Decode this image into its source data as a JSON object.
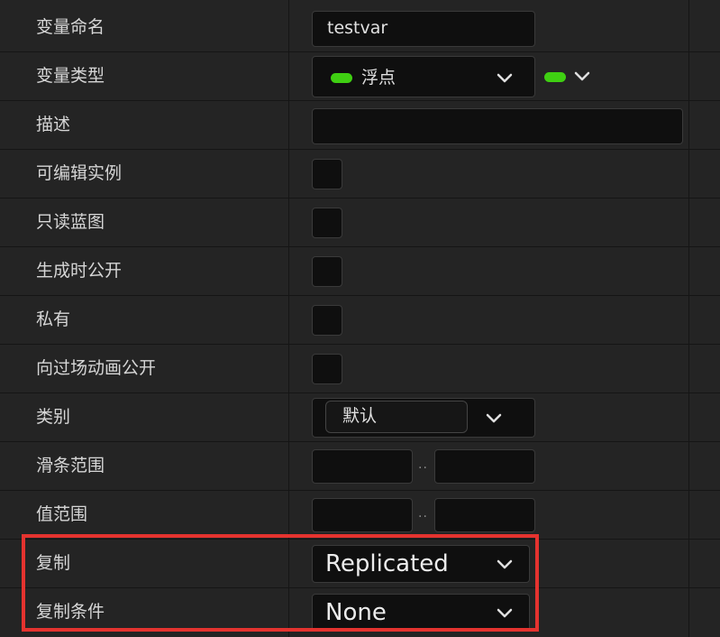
{
  "rows": {
    "var_name": {
      "label": "变量命名",
      "value": "testvar"
    },
    "var_type": {
      "label": "变量类型",
      "value": "浮点"
    },
    "description": {
      "label": "描述",
      "value": ""
    },
    "instance_editable": {
      "label": "可编辑实例"
    },
    "blueprint_readonly": {
      "label": "只读蓝图"
    },
    "expose_on_spawn": {
      "label": "生成时公开"
    },
    "private": {
      "label": "私有"
    },
    "expose_to_cinematics": {
      "label": "向过场动画公开"
    },
    "category": {
      "label": "类别",
      "value": "默认"
    },
    "slider_range": {
      "label": "滑条范围",
      "separator": ".."
    },
    "value_range": {
      "label": "值范围",
      "separator": ".."
    },
    "replication": {
      "label": "复制",
      "value": "Replicated"
    },
    "replication_condition": {
      "label": "复制条件",
      "value": "None"
    }
  },
  "colors": {
    "type_pill": "#3fcf12",
    "highlight": "#e5332f"
  },
  "icons": [
    "chevron-down-icon",
    "type-pill-icon"
  ]
}
